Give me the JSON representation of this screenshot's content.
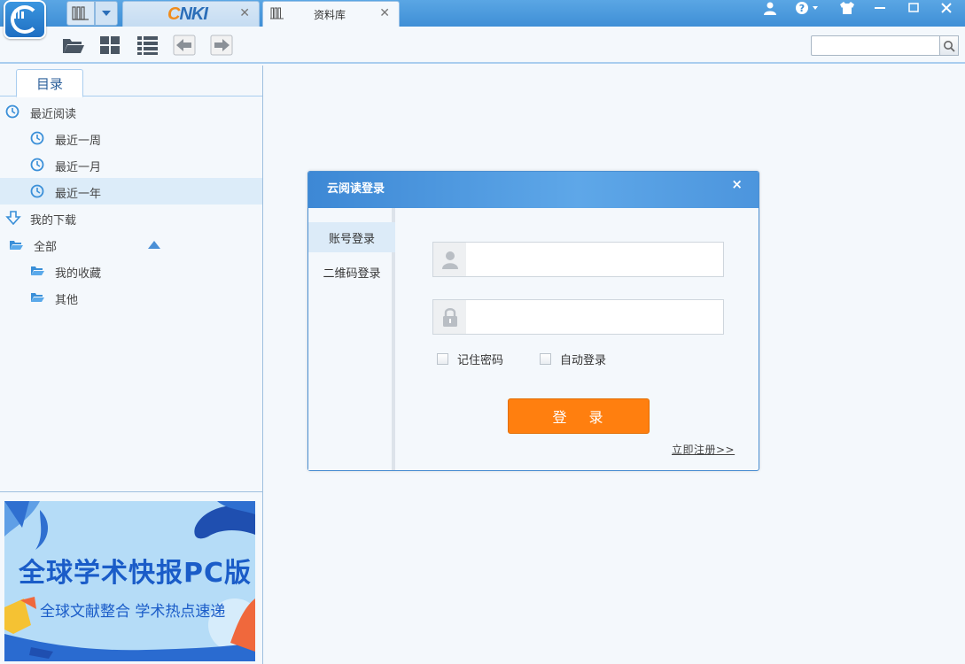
{
  "tabs": {
    "cnki_label_c": "C",
    "cnki_label_rest": "NKI",
    "library_label": "资料库"
  },
  "sidebar": {
    "dir_tab": "目录",
    "items": [
      {
        "label": "最近阅读",
        "icon": "clock-icon"
      },
      {
        "label": "最近一周",
        "icon": "clock-icon"
      },
      {
        "label": "最近一月",
        "icon": "clock-icon"
      },
      {
        "label": "最近一年",
        "icon": "clock-icon",
        "selected": true
      },
      {
        "label": "我的下载",
        "icon": "download-icon"
      },
      {
        "label": "全部",
        "icon": "folder-icon"
      },
      {
        "label": "我的收藏",
        "icon": "folder-icon"
      },
      {
        "label": "其他",
        "icon": "folder-icon"
      }
    ]
  },
  "banner": {
    "title": "全球学术快报PC版",
    "subtitle": "全球文献整合  学术热点速递"
  },
  "dialog": {
    "title": "云阅读登录",
    "close_glyph": "×",
    "tabs": [
      "账号登录",
      "二维码登录"
    ],
    "remember_password": "记住密码",
    "auto_login": "自动登录",
    "login_button": "登 录",
    "register_link": "立即注册>>"
  },
  "colors": {
    "accent": "#3f8fd6",
    "login_button": "#ff7f0f",
    "selected_row": "#dcecf9"
  }
}
